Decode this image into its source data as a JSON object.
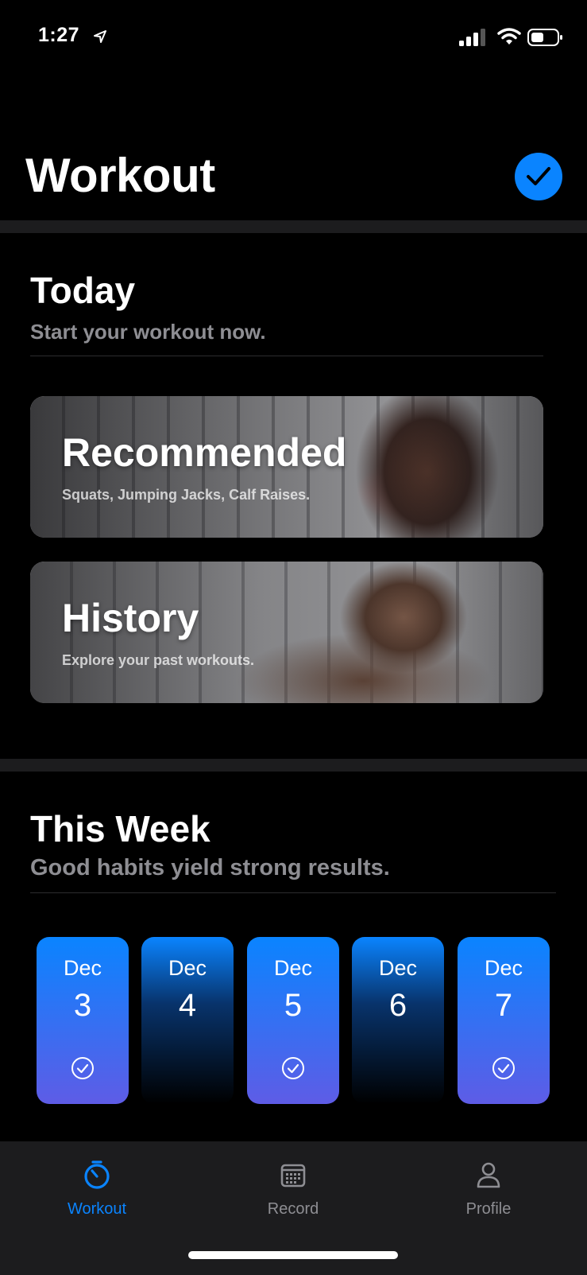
{
  "status_bar": {
    "time": "1:27",
    "location_icon": "location-arrow-icon",
    "signal_icon": "cellular-signal-icon",
    "wifi_icon": "wifi-icon",
    "battery_icon": "battery-icon"
  },
  "header": {
    "title": "Workout",
    "action_icon": "checkmark-circle-icon",
    "accent_color": "#0a84ff"
  },
  "today": {
    "title": "Today",
    "subtitle": "Start your workout now.",
    "cards": [
      {
        "title": "Recommended",
        "subtitle": "Squats, Jumping Jacks, Calf Raises."
      },
      {
        "title": "History",
        "subtitle": "Explore your past workouts."
      }
    ]
  },
  "week": {
    "title": "This Week",
    "subtitle": "Good habits yield strong results.",
    "days": [
      {
        "month": "Dec",
        "day": "3",
        "completed": true
      },
      {
        "month": "Dec",
        "day": "4",
        "completed": false
      },
      {
        "month": "Dec",
        "day": "5",
        "completed": true
      },
      {
        "month": "Dec",
        "day": "6",
        "completed": false
      },
      {
        "month": "Dec",
        "day": "7",
        "completed": true
      }
    ]
  },
  "tabbar": {
    "tabs": [
      {
        "label": "Workout",
        "icon": "stopwatch-icon",
        "active": true
      },
      {
        "label": "Record",
        "icon": "calendar-icon",
        "active": false
      },
      {
        "label": "Profile",
        "icon": "person-icon",
        "active": false
      }
    ]
  }
}
